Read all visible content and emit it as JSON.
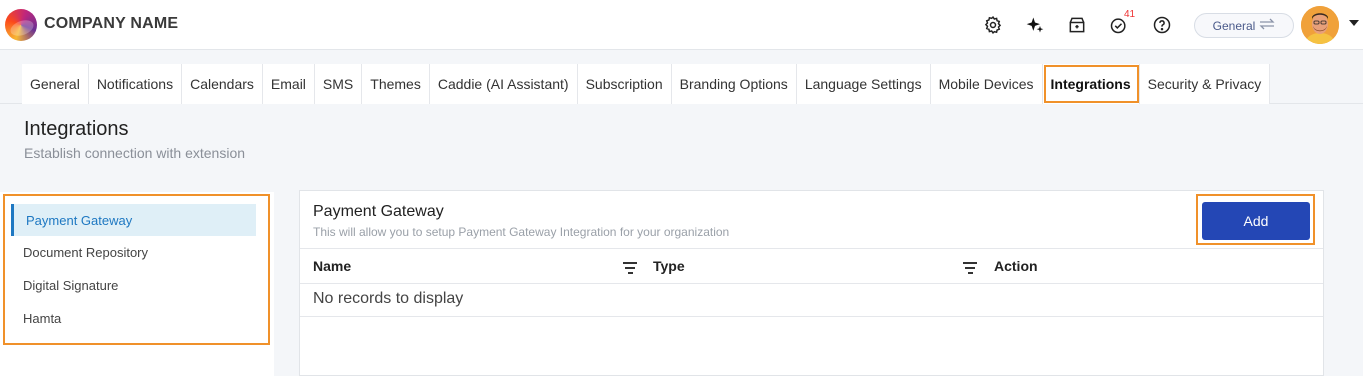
{
  "header": {
    "company_name": "COMPANY NAME",
    "notification_count": "41",
    "context_label": "General",
    "icons": [
      "settings-icon",
      "sparkle-icon",
      "store-icon",
      "task-check-icon",
      "help-icon",
      "swap-icon",
      "avatar",
      "caret-down-icon"
    ]
  },
  "tabs": [
    {
      "label": "General"
    },
    {
      "label": "Notifications"
    },
    {
      "label": "Calendars"
    },
    {
      "label": "Email"
    },
    {
      "label": "SMS"
    },
    {
      "label": "Themes"
    },
    {
      "label": "Caddie (AI Assistant)"
    },
    {
      "label": "Subscription"
    },
    {
      "label": "Branding Options"
    },
    {
      "label": "Language Settings"
    },
    {
      "label": "Mobile Devices"
    },
    {
      "label": "Integrations",
      "active": true
    },
    {
      "label": "Security & Privacy"
    }
  ],
  "page": {
    "title": "Integrations",
    "subtitle": "Establish connection with extension"
  },
  "sidebar": {
    "items": [
      {
        "label": "Payment Gateway",
        "active": true
      },
      {
        "label": "Document Repository"
      },
      {
        "label": "Digital Signature"
      },
      {
        "label": "Hamta"
      }
    ]
  },
  "panel": {
    "title": "Payment Gateway",
    "subtitle": "This will allow you to setup Payment Gateway Integration for your organization",
    "add_label": "Add",
    "columns": [
      "Name",
      "Type",
      "Action"
    ],
    "empty_text": "No records to display"
  },
  "colors": {
    "accent_outline": "#f0912a",
    "primary_button": "#2447b5",
    "active_nav": "#1e78c2"
  }
}
